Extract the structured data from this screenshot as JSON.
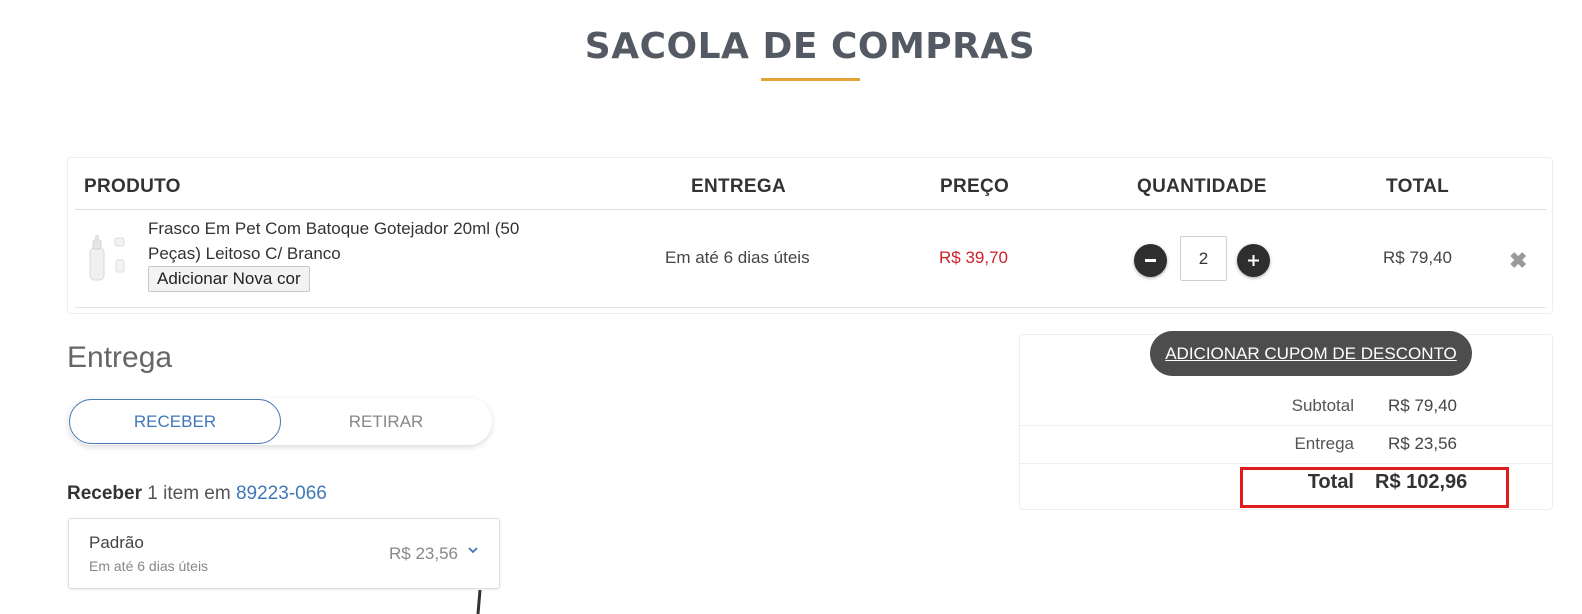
{
  "header": {
    "title": "SACOLA DE COMPRAS",
    "accent_color": "#e2a336"
  },
  "cart": {
    "columns": [
      "PRODUTO",
      "ENTREGA",
      "PREÇO",
      "QUANTIDADE",
      "TOTAL"
    ],
    "items": [
      {
        "name": "Frasco Em Pet Com Batoque Gotejador 20ml (50 Peças) Leitoso C/ Branco",
        "add_color_label": "Adicionar Nova cor",
        "delivery": "Em até 6 dias úteis",
        "price": "R$ 39,70",
        "price_color": "#d0202b",
        "quantity": "2",
        "total": "R$ 79,40",
        "decrement_icon": "minus-icon",
        "increment_icon": "plus-icon",
        "remove_icon": "close-icon"
      }
    ]
  },
  "delivery": {
    "heading": "Entrega",
    "tabs": [
      {
        "label": "RECEBER",
        "active": true
      },
      {
        "label": "RETIRAR",
        "active": false
      }
    ],
    "receber_prefix": "Receber",
    "receber_middle": "1 item em",
    "cep": "89223-066",
    "option": {
      "name": "Padrão",
      "eta": "Em até 6 dias úteis",
      "price": "R$ 23,56",
      "icon": "chevron-down-icon"
    }
  },
  "summary": {
    "coupon_label": "ADICIONAR CUPOM DE DESCONTO",
    "subtotal_label": "Subtotal",
    "subtotal_value": "R$ 79,40",
    "shipping_label": "Entrega",
    "shipping_value": "R$ 23,56",
    "total_label": "Total",
    "total_value": "R$ 102,96",
    "highlight_color": "#e01b1b"
  }
}
